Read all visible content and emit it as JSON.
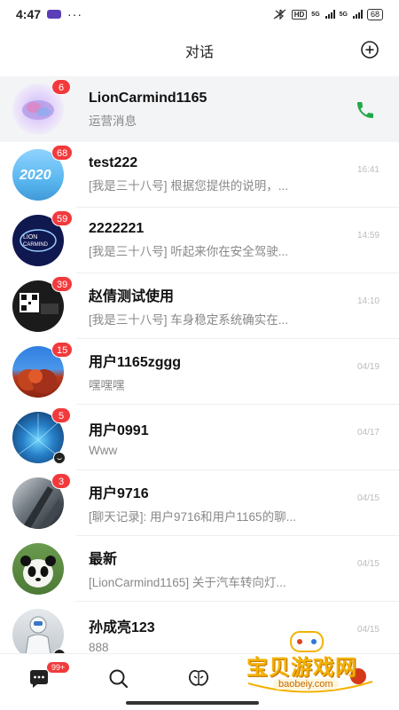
{
  "status_bar": {
    "time": "4:47",
    "dots": "···",
    "hd": "HD",
    "sig1": "5G",
    "sig2": "5G",
    "battery": "68"
  },
  "header": {
    "title": "对话"
  },
  "conversations": [
    {
      "name": "LionCarmind1165",
      "message": "运营消息",
      "time": "",
      "badge": "6",
      "pinned": true
    },
    {
      "name": "test222",
      "message": "[我是三十八号] 根据您提供的说明，...",
      "time": "16:41",
      "badge": "68"
    },
    {
      "name": "2222221",
      "message": "[我是三十八号] 听起来你在安全驾驶...",
      "time": "14:59",
      "badge": "59"
    },
    {
      "name": "赵倩测试使用",
      "message": "[我是三十八号] 车身稳定系统确实在...",
      "time": "14:10",
      "badge": "39"
    },
    {
      "name": "用户1165zggg",
      "message": "嘿嘿嘿",
      "time": "04/19",
      "badge": "15"
    },
    {
      "name": "用户0991",
      "message": "Www",
      "time": "04/17",
      "badge": "5"
    },
    {
      "name": "用户9716",
      "message": "[聊天记录]: 用户9716和用户1165的聊...",
      "time": "04/15",
      "badge": "3"
    },
    {
      "name": "最新",
      "message": "[LionCarmind1165] 关于汽车转向灯...",
      "time": "04/15",
      "badge": ""
    },
    {
      "name": "孙成亮123",
      "message": "888",
      "time": "04/15",
      "badge": ""
    }
  ],
  "tab_bar": {
    "chat_badge": "99+"
  },
  "watermark": {
    "text": "宝贝游戏网",
    "url": "baobeiy.com"
  }
}
